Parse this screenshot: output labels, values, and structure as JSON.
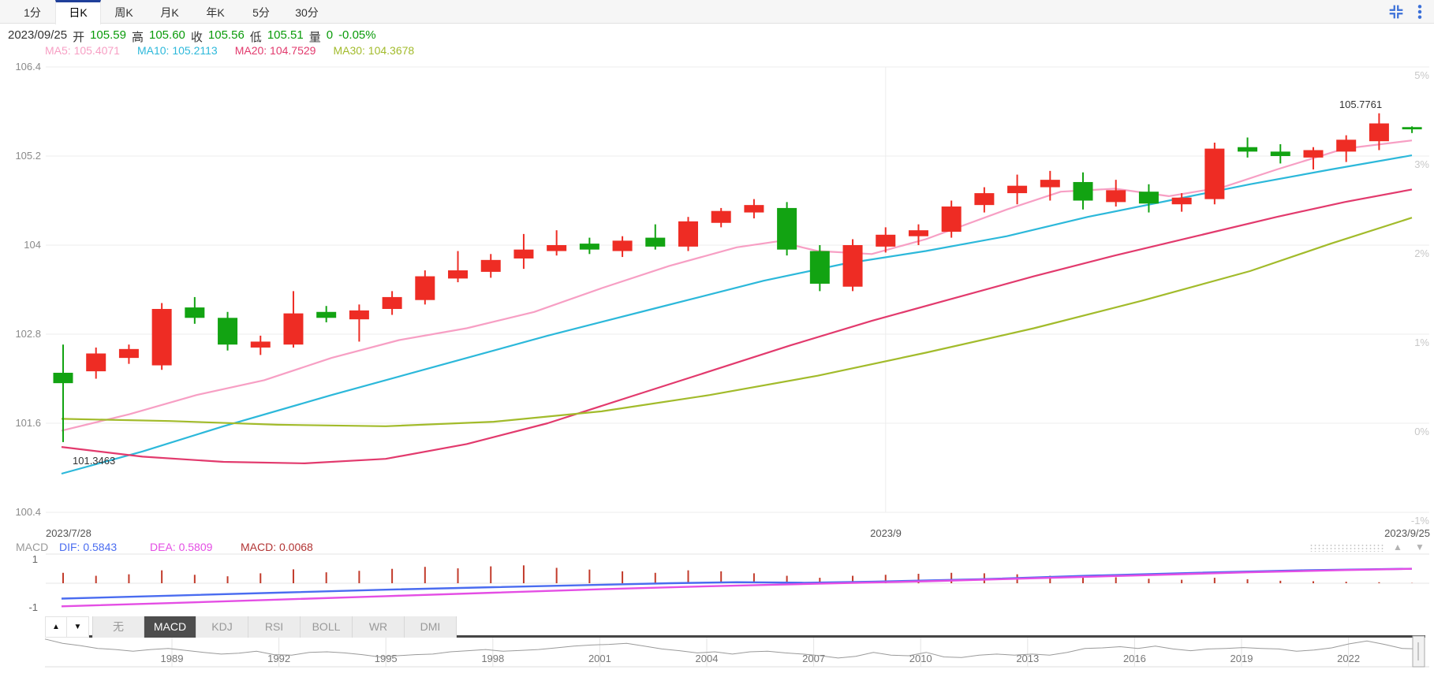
{
  "toolbar": {
    "tabs": [
      {
        "label": "1分",
        "selected": false
      },
      {
        "label": "日K",
        "selected": true
      },
      {
        "label": "周K",
        "selected": false
      },
      {
        "label": "月K",
        "selected": false
      },
      {
        "label": "年K",
        "selected": false
      },
      {
        "label": "5分",
        "selected": false
      },
      {
        "label": "30分",
        "selected": false
      }
    ],
    "icons": {
      "collapse": "collapse-icon",
      "more": "kebab-menu-icon"
    },
    "accent_blue": "#3a6fd8"
  },
  "quote": {
    "date": "2023/09/25",
    "fields": [
      {
        "label": "开",
        "value": "105.59"
      },
      {
        "label": "高",
        "value": "105.60"
      },
      {
        "label": "收",
        "value": "105.56"
      },
      {
        "label": "低",
        "value": "105.51"
      },
      {
        "label": "量",
        "value": "0"
      }
    ],
    "change": "-0.05%",
    "value_color": "#0a9b0a"
  },
  "ma_legend": [
    {
      "label": "MA5: 105.4071",
      "color": "#f79fc4"
    },
    {
      "label": "MA10: 105.2113",
      "color": "#2cb8da"
    },
    {
      "label": "MA20: 104.7529",
      "color": "#e23a6d"
    },
    {
      "label": "MA30: 104.3678",
      "color": "#a2bb2b"
    }
  ],
  "macd_row": {
    "title": "MACD",
    "dif": "DIF: 0.5843",
    "dea": "DEA: 0.5809",
    "macd": "MACD: 0.0068",
    "title_color": "#999999",
    "dif_color": "#4a6cf0",
    "dea_color": "#e44ee4",
    "macd_color": "#b23434"
  },
  "macd_axis": {
    "top": "1",
    "bottom": "-1"
  },
  "panel_buttons": {
    "collapse_up": "▲",
    "collapse_down": "▼"
  },
  "indicator_bar": {
    "up": "▲",
    "down": "▼",
    "tabs": [
      {
        "label": "无",
        "selected": false
      },
      {
        "label": "MACD",
        "selected": true
      },
      {
        "label": "KDJ",
        "selected": false
      },
      {
        "label": "RSI",
        "selected": false
      },
      {
        "label": "BOLL",
        "selected": false
      },
      {
        "label": "WR",
        "selected": false
      },
      {
        "label": "DMI",
        "selected": false
      }
    ]
  },
  "chart_data": {
    "type": "candlestick",
    "y_axis_left": {
      "labels": [
        "106.4",
        "105.2",
        "104",
        "102.8",
        "101.6",
        "100.4"
      ],
      "max": 106.4,
      "min": 100.4
    },
    "y_axis_right": {
      "labels": [
        "5%",
        "3%",
        "2%",
        "1%",
        "0%",
        "-1%"
      ]
    },
    "x_labels": {
      "left": "2023/7/28",
      "center": "2023/9",
      "right": "2023/9/25"
    },
    "annotations": {
      "high_label": "105.7761",
      "low_label": "101.3463"
    },
    "colors": {
      "up": "#ee2c24",
      "down": "#12a312",
      "ma5": "#f79fc4",
      "ma10": "#2cb8da",
      "ma20": "#e23a6d",
      "ma30": "#a2bb2b",
      "dif": "#4a6cf0",
      "dea": "#e44ee4",
      "hist": "#c23b2b",
      "grid": "#ededed"
    },
    "candles": [
      [
        102.28,
        102.66,
        101.3463,
        102.14
      ],
      [
        102.3,
        102.62,
        102.2,
        102.54
      ],
      [
        102.48,
        102.66,
        102.4,
        102.6
      ],
      [
        102.38,
        103.22,
        102.32,
        103.14
      ],
      [
        103.16,
        103.3,
        102.94,
        103.02
      ],
      [
        103.02,
        103.1,
        102.58,
        102.66
      ],
      [
        102.62,
        102.78,
        102.52,
        102.7
      ],
      [
        102.66,
        103.38,
        102.62,
        103.08
      ],
      [
        103.1,
        103.18,
        102.96,
        103.02
      ],
      [
        103.0,
        103.2,
        102.7,
        103.12
      ],
      [
        103.14,
        103.38,
        103.06,
        103.3
      ],
      [
        103.26,
        103.66,
        103.2,
        103.58
      ],
      [
        103.55,
        103.92,
        103.5,
        103.66
      ],
      [
        103.64,
        103.88,
        103.56,
        103.8
      ],
      [
        103.82,
        104.15,
        103.68,
        103.94
      ],
      [
        103.92,
        104.2,
        103.86,
        104.0
      ],
      [
        104.02,
        104.1,
        103.88,
        103.94
      ],
      [
        103.92,
        104.12,
        103.84,
        104.06
      ],
      [
        104.1,
        104.28,
        103.94,
        103.98
      ],
      [
        103.98,
        104.38,
        103.92,
        104.32
      ],
      [
        104.3,
        104.5,
        104.24,
        104.46
      ],
      [
        104.44,
        104.62,
        104.36,
        104.54
      ],
      [
        104.5,
        104.58,
        103.86,
        103.94
      ],
      [
        103.92,
        104.0,
        103.38,
        103.48
      ],
      [
        103.44,
        104.08,
        103.38,
        104.0
      ],
      [
        103.98,
        104.24,
        103.9,
        104.14
      ],
      [
        104.12,
        104.28,
        104.0,
        104.2
      ],
      [
        104.18,
        104.6,
        104.1,
        104.52
      ],
      [
        104.54,
        104.78,
        104.44,
        104.7
      ],
      [
        104.7,
        104.95,
        104.55,
        104.8
      ],
      [
        104.78,
        105.0,
        104.6,
        104.88
      ],
      [
        104.85,
        104.98,
        104.48,
        104.6
      ],
      [
        104.58,
        104.88,
        104.52,
        104.74
      ],
      [
        104.72,
        104.82,
        104.44,
        104.56
      ],
      [
        104.55,
        104.7,
        104.45,
        104.64
      ],
      [
        104.62,
        105.38,
        104.55,
        105.3
      ],
      [
        105.32,
        105.45,
        105.18,
        105.26
      ],
      [
        105.26,
        105.36,
        105.1,
        105.2
      ],
      [
        105.18,
        105.32,
        105.02,
        105.28
      ],
      [
        105.26,
        105.48,
        105.12,
        105.42
      ],
      [
        105.4,
        105.7761,
        105.28,
        105.64
      ],
      [
        105.59,
        105.6,
        105.51,
        105.56
      ]
    ],
    "ma_lines": [
      {
        "name": "MA5",
        "key": "ma5",
        "points": [
          [
            0,
            101.5
          ],
          [
            0.05,
            101.72
          ],
          [
            0.1,
            101.98
          ],
          [
            0.15,
            102.18
          ],
          [
            0.2,
            102.48
          ],
          [
            0.25,
            102.72
          ],
          [
            0.3,
            102.88
          ],
          [
            0.35,
            103.1
          ],
          [
            0.4,
            103.42
          ],
          [
            0.45,
            103.72
          ],
          [
            0.5,
            103.97
          ],
          [
            0.53,
            104.05
          ],
          [
            0.56,
            103.92
          ],
          [
            0.6,
            103.88
          ],
          [
            0.64,
            104.08
          ],
          [
            0.7,
            104.48
          ],
          [
            0.74,
            104.72
          ],
          [
            0.78,
            104.76
          ],
          [
            0.82,
            104.66
          ],
          [
            0.86,
            104.78
          ],
          [
            0.9,
            105.02
          ],
          [
            0.95,
            105.3
          ],
          [
            1,
            105.41
          ]
        ]
      },
      {
        "name": "MA10",
        "key": "ma10",
        "points": [
          [
            0,
            100.92
          ],
          [
            0.06,
            101.22
          ],
          [
            0.12,
            101.56
          ],
          [
            0.2,
            101.98
          ],
          [
            0.28,
            102.38
          ],
          [
            0.36,
            102.78
          ],
          [
            0.44,
            103.15
          ],
          [
            0.52,
            103.52
          ],
          [
            0.58,
            103.75
          ],
          [
            0.64,
            103.92
          ],
          [
            0.7,
            104.12
          ],
          [
            0.76,
            104.38
          ],
          [
            0.82,
            104.6
          ],
          [
            0.88,
            104.82
          ],
          [
            0.94,
            105.02
          ],
          [
            1,
            105.21
          ]
        ]
      },
      {
        "name": "MA20",
        "key": "ma20",
        "points": [
          [
            0,
            101.28
          ],
          [
            0.06,
            101.15
          ],
          [
            0.12,
            101.08
          ],
          [
            0.18,
            101.06
          ],
          [
            0.24,
            101.12
          ],
          [
            0.3,
            101.32
          ],
          [
            0.36,
            101.6
          ],
          [
            0.42,
            101.95
          ],
          [
            0.48,
            102.3
          ],
          [
            0.54,
            102.65
          ],
          [
            0.6,
            102.98
          ],
          [
            0.66,
            103.28
          ],
          [
            0.72,
            103.58
          ],
          [
            0.78,
            103.86
          ],
          [
            0.84,
            104.12
          ],
          [
            0.9,
            104.38
          ],
          [
            0.95,
            104.58
          ],
          [
            1,
            104.75
          ]
        ]
      },
      {
        "name": "MA30",
        "key": "ma30",
        "points": [
          [
            0,
            101.66
          ],
          [
            0.08,
            101.63
          ],
          [
            0.16,
            101.58
          ],
          [
            0.24,
            101.56
          ],
          [
            0.32,
            101.62
          ],
          [
            0.4,
            101.76
          ],
          [
            0.48,
            101.98
          ],
          [
            0.56,
            102.24
          ],
          [
            0.64,
            102.55
          ],
          [
            0.72,
            102.88
          ],
          [
            0.8,
            103.25
          ],
          [
            0.88,
            103.65
          ],
          [
            0.94,
            104.02
          ],
          [
            1,
            104.37
          ]
        ]
      }
    ],
    "macd_panel": {
      "range": [
        1,
        -1
      ],
      "dif": [
        [
          0,
          -0.62
        ],
        [
          0.08,
          -0.5
        ],
        [
          0.16,
          -0.38
        ],
        [
          0.24,
          -0.26
        ],
        [
          0.32,
          -0.16
        ],
        [
          0.4,
          -0.06
        ],
        [
          0.45,
          0.0
        ],
        [
          0.5,
          0.04
        ],
        [
          0.55,
          0.02
        ],
        [
          0.6,
          0.06
        ],
        [
          0.68,
          0.16
        ],
        [
          0.76,
          0.3
        ],
        [
          0.84,
          0.42
        ],
        [
          0.92,
          0.52
        ],
        [
          1,
          0.5843
        ]
      ],
      "dea": [
        [
          0,
          -0.93
        ],
        [
          0.08,
          -0.8
        ],
        [
          0.16,
          -0.66
        ],
        [
          0.24,
          -0.52
        ],
        [
          0.32,
          -0.38
        ],
        [
          0.4,
          -0.24
        ],
        [
          0.48,
          -0.12
        ],
        [
          0.56,
          -0.02
        ],
        [
          0.64,
          0.08
        ],
        [
          0.72,
          0.2
        ],
        [
          0.8,
          0.32
        ],
        [
          0.88,
          0.44
        ],
        [
          0.95,
          0.53
        ],
        [
          1,
          0.5809
        ]
      ],
      "histogram": [
        0.42,
        0.3,
        0.36,
        0.52,
        0.34,
        0.28,
        0.4,
        0.56,
        0.44,
        0.5,
        0.58,
        0.66,
        0.6,
        0.68,
        0.72,
        0.62,
        0.55,
        0.48,
        0.42,
        0.52,
        0.48,
        0.4,
        0.3,
        0.22,
        0.3,
        0.34,
        0.38,
        0.42,
        0.4,
        0.36,
        0.3,
        0.22,
        0.24,
        0.18,
        0.14,
        0.22,
        0.16,
        0.1,
        0.08,
        0.06,
        0.04,
        0.01
      ]
    },
    "minimap": {
      "years": [
        "1989",
        "1992",
        "1995",
        "1998",
        "2001",
        "2004",
        "2007",
        "2010",
        "2013",
        "2016",
        "2019",
        "2022"
      ],
      "values": [
        95,
        80,
        72,
        62,
        58,
        52,
        58,
        62,
        55,
        48,
        42,
        45,
        52,
        40,
        38,
        48,
        50,
        46,
        40,
        32,
        36,
        40,
        42,
        50,
        54,
        58,
        52,
        55,
        58,
        64,
        70,
        74,
        76,
        80,
        70,
        60,
        54,
        46,
        50,
        42,
        50,
        52,
        46,
        42,
        36,
        28,
        34,
        48,
        38,
        36,
        48,
        32,
        30,
        38,
        42,
        38,
        42,
        38,
        48,
        62,
        64,
        68,
        62,
        70,
        60,
        54,
        60,
        62,
        65,
        62,
        60,
        52,
        56,
        64,
        78,
        88,
        76,
        62,
        60
      ]
    }
  }
}
